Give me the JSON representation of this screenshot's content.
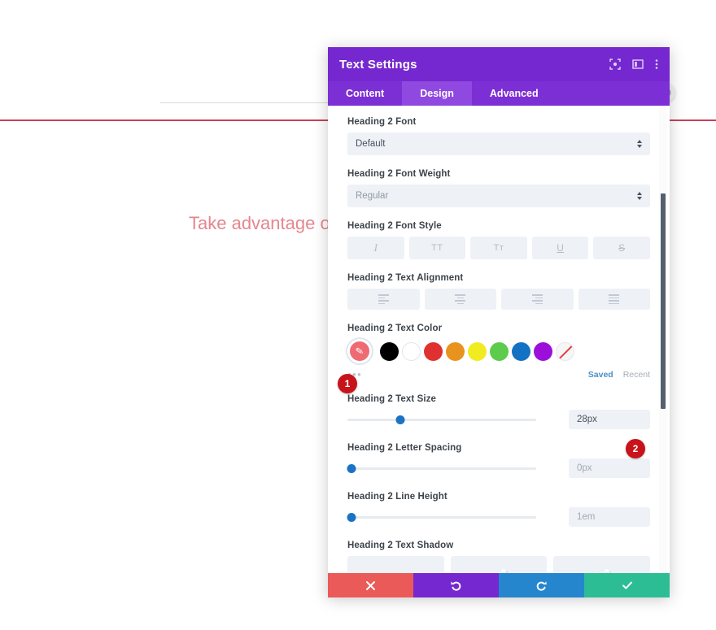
{
  "background": {
    "heading_text": "Take advantage o",
    "heading_color": "#e4868f",
    "divider_color": "#c9405a",
    "circle_icon": "globe-icon"
  },
  "modal": {
    "title": "Text Settings",
    "header_icons": [
      {
        "name": "responsive-view-icon",
        "glyph": "target"
      },
      {
        "name": "split-view-icon",
        "glyph": "columns"
      },
      {
        "name": "more-options-icon",
        "glyph": "kebab"
      }
    ],
    "tabs": [
      {
        "label": "Content",
        "active": false
      },
      {
        "label": "Design",
        "active": true
      },
      {
        "label": "Advanced",
        "active": false
      }
    ],
    "fields": {
      "font": {
        "label": "Heading 2 Font",
        "value": "Default"
      },
      "font_weight": {
        "label": "Heading 2 Font Weight",
        "value": "Regular"
      },
      "font_style": {
        "label": "Heading 2 Font Style",
        "buttons": [
          "I",
          "TT",
          "Tᴛ",
          "U",
          "S"
        ]
      },
      "text_alignment": {
        "label": "Heading 2 Text Alignment",
        "buttons": [
          "align-left",
          "align-center",
          "align-right",
          "align-justify"
        ]
      },
      "text_color": {
        "label": "Heading 2 Text Color",
        "active_swatch": "#ef6b72",
        "swatches": [
          "#000000",
          "#ffffff",
          "#e03131",
          "#e8931e",
          "#f0ec1f",
          "#5dcb4b",
          "#1472c4",
          "#9c0fdb"
        ],
        "transparent_label": "transparent-swatch",
        "more_label": "•••",
        "saved_label": "Saved",
        "recent_label": "Recent"
      },
      "text_size": {
        "label": "Heading 2 Text Size",
        "value": "28px",
        "slider_percent": 28
      },
      "letter_spacing": {
        "label": "Heading 2 Letter Spacing",
        "value": "0px",
        "slider_percent": 0
      },
      "line_height": {
        "label": "Heading 2 Line Height",
        "value": "1em",
        "slider_percent": 0
      },
      "text_shadow": {
        "label": "Heading 2 Text Shadow",
        "options": [
          "none",
          "aA",
          "aA"
        ]
      }
    },
    "footer": {
      "cancel": "✖",
      "undo": "↺",
      "redo": "↻",
      "save": "✔"
    }
  },
  "annotations": {
    "badge1": "1",
    "badge2": "2",
    "badge_color": "#c9131a"
  }
}
